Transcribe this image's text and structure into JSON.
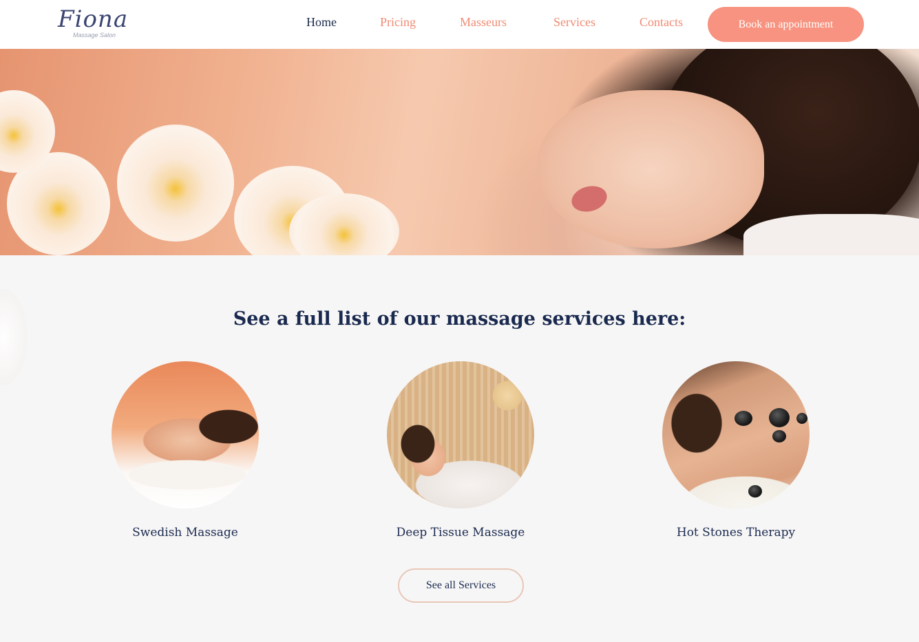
{
  "header": {
    "logo": {
      "name": "Fiona",
      "subtitle": "Massage Salon"
    },
    "nav": [
      {
        "label": "Home",
        "active": true
      },
      {
        "label": "Pricing",
        "active": false
      },
      {
        "label": "Masseurs",
        "active": false
      },
      {
        "label": "Services",
        "active": false
      },
      {
        "label": "Contacts",
        "active": false
      }
    ],
    "cta_label": "Book an appointment"
  },
  "hero": {
    "image": "woman-relaxing-massage-with-orchids"
  },
  "services": {
    "title": "See a full list of our massage services here:",
    "items": [
      {
        "name": "Swedish Massage",
        "image": "swedish-massage-photo"
      },
      {
        "name": "Deep Tissue Massage",
        "image": "deep-tissue-massage-photo"
      },
      {
        "name": "Hot Stones Therapy",
        "image": "hot-stones-therapy-photo"
      }
    ],
    "see_all_label": "See all Services"
  },
  "colors": {
    "accent": "#f79380",
    "nav_link": "#f08b74",
    "navy": "#1a2a4f",
    "background": "#f7f6f6"
  }
}
